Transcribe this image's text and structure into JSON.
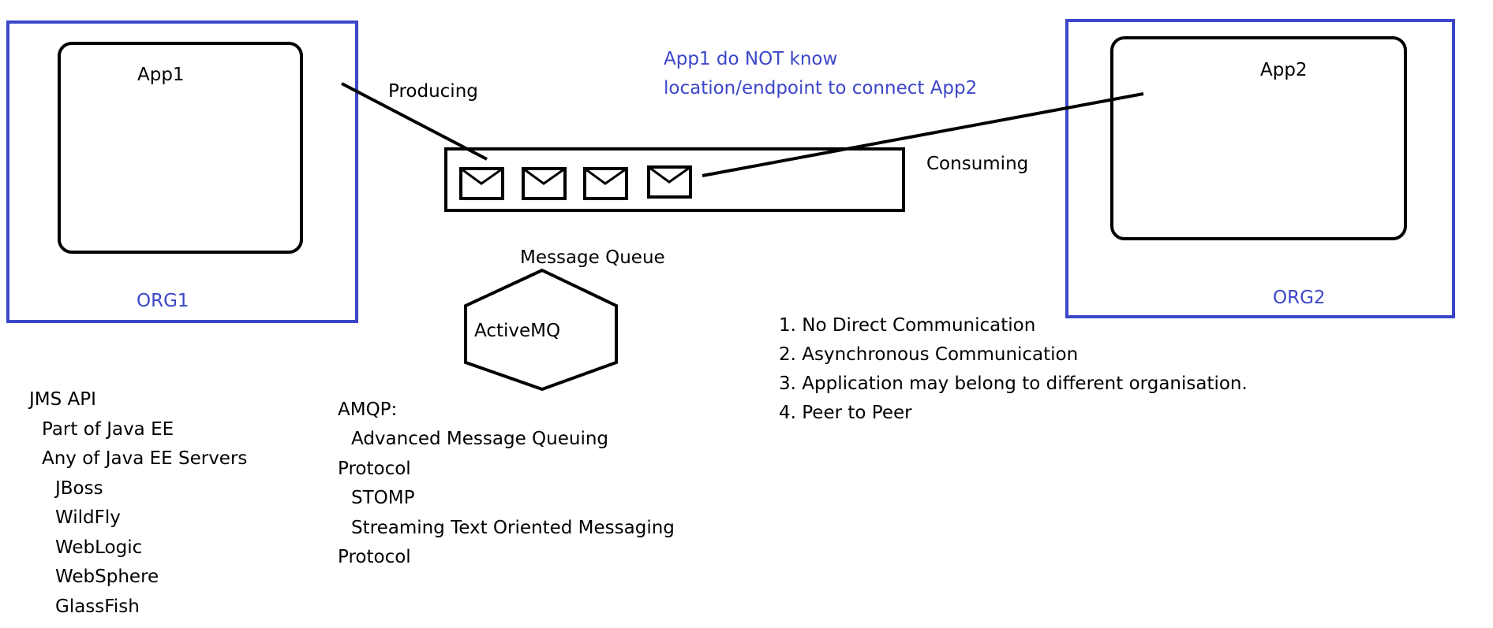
{
  "colors": {
    "org_border": "#3c46c8",
    "org_text": "#3c46c8",
    "ink": "#000000"
  },
  "org1": {
    "app_label": "App1",
    "org_label": "ORG1"
  },
  "org2": {
    "app_label": "App2",
    "org_label": "ORG2"
  },
  "producing_label": "Producing",
  "consuming_label": "Consuming",
  "note_lines": [
    "App1 do NOT know",
    "location/endpoint to connect App2"
  ],
  "queue": {
    "caption": "Message Queue",
    "message_icons": [
      "envelope-icon",
      "envelope-icon",
      "envelope-icon",
      "envelope-icon"
    ]
  },
  "broker_label": "ActiveMQ",
  "points": [
    "1. No Direct Communication",
    "2. Asynchronous Communication",
    "3. Application may belong to different organisation.",
    "4. Peer to Peer"
  ],
  "jms": {
    "title": "JMS API",
    "items": [
      "Part of Java EE",
      "Any of Java EE Servers"
    ],
    "servers": [
      "JBoss",
      "WildFly",
      "WebLogic",
      "WebSphere",
      "GlassFish"
    ]
  },
  "protocols": {
    "amqp_title": "AMQP:",
    "amqp_desc": "Advanced Message Queuing",
    "amqp_protocol": "Protocol",
    "stomp_title": "STOMP",
    "stomp_desc": "Streaming Text Oriented Messaging",
    "stomp_protocol": "Protocol"
  }
}
